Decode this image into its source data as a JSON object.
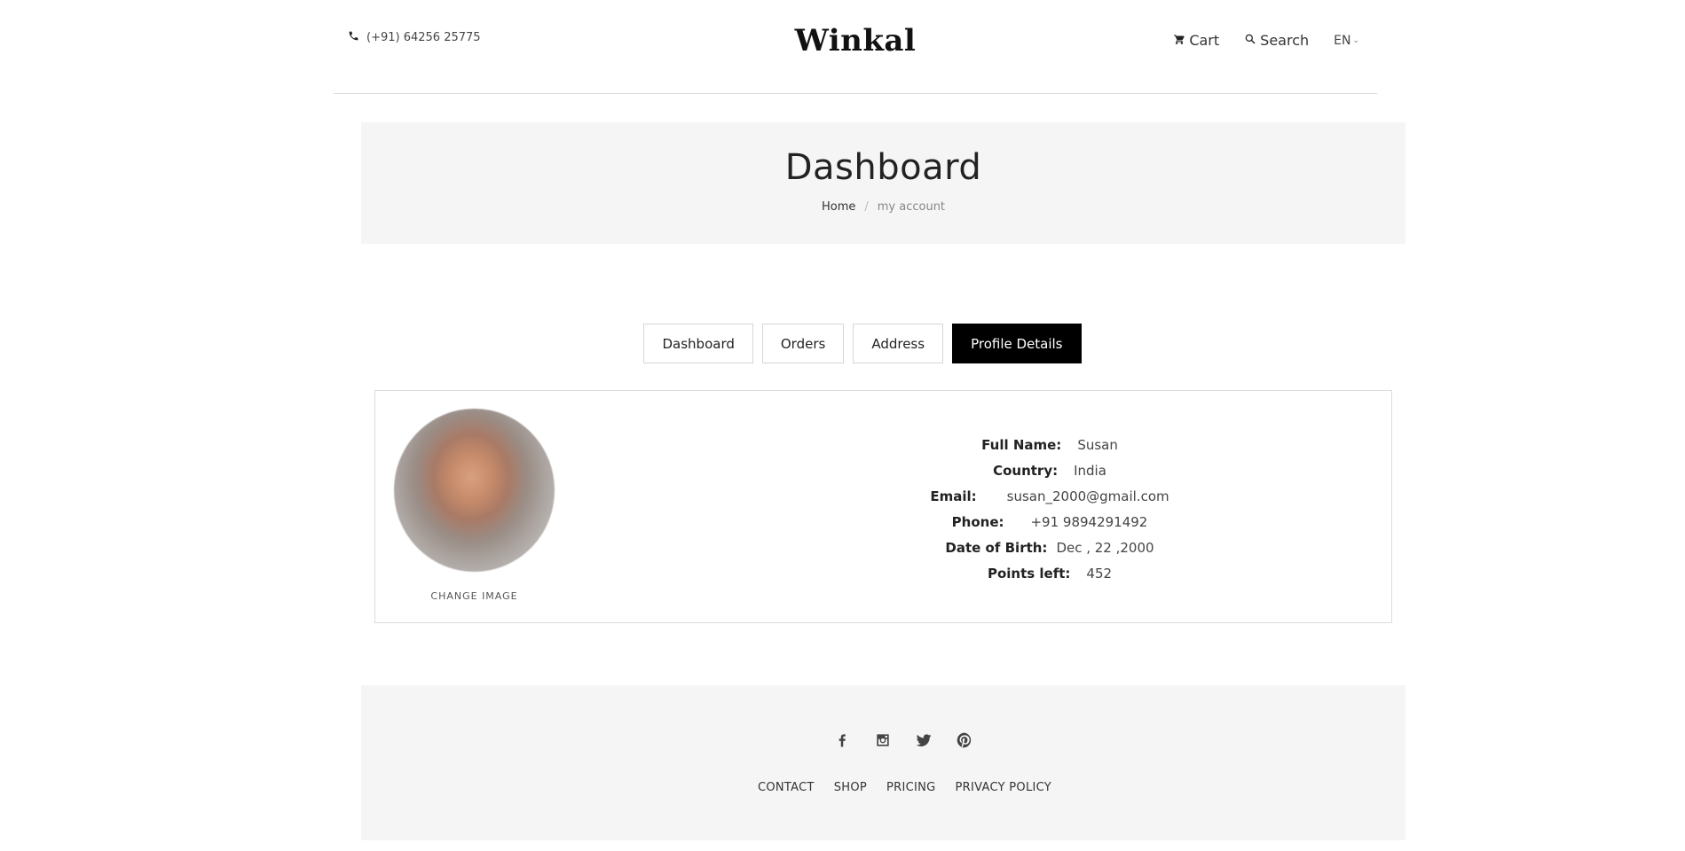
{
  "header": {
    "phone": "(+91) 64256 25775",
    "logo": "Winkal",
    "cart_label": "Cart",
    "search_label": "Search",
    "language": "EN"
  },
  "banner": {
    "title": "Dashboard",
    "breadcrumb": {
      "home": "Home",
      "separator": "/",
      "current": "my account"
    }
  },
  "tabs": [
    {
      "label": "Dashboard",
      "active": false
    },
    {
      "label": "Orders",
      "active": false
    },
    {
      "label": "Address",
      "active": false
    },
    {
      "label": "Profile Details",
      "active": true
    }
  ],
  "profile": {
    "change_image_label": "CHANGE IMAGE",
    "fields": [
      {
        "label": "Full Name:",
        "value": "Susan"
      },
      {
        "label": "Country:",
        "value": "India"
      },
      {
        "label": "Email:",
        "value": "susan_2000@gmail.com"
      },
      {
        "label": "Phone:",
        "value": "+91 9894291492"
      },
      {
        "label": "Date of Birth:",
        "value": "Dec , 22 ,2000"
      },
      {
        "label": "Points left:",
        "value": "452"
      }
    ]
  },
  "footer": {
    "social_icons": [
      "facebook-icon",
      "instagram-icon",
      "twitter-icon",
      "pinterest-icon"
    ],
    "links": [
      "CONTACT",
      "SHOP",
      "PRICING",
      "PRIVACY POLICY"
    ]
  },
  "colors": {
    "accent": "#000000",
    "banner_bg": "#f5f5f5",
    "border": "#dcdcdc"
  }
}
